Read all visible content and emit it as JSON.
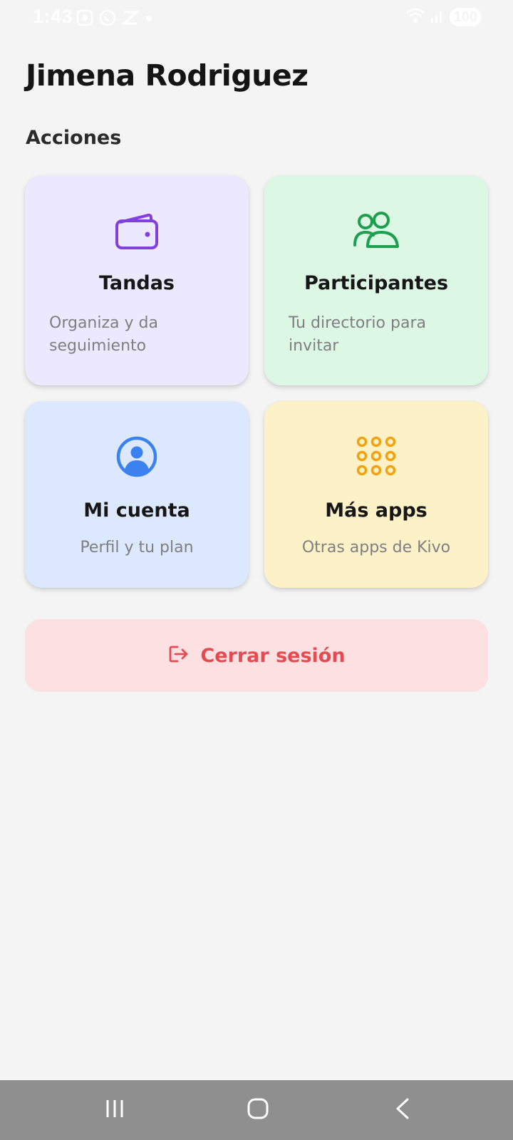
{
  "status_bar": {
    "time": "1:43",
    "battery": "100",
    "left_icons": [
      "screenshot-icon",
      "whatsapp-icon",
      "app-notification-icon",
      "notification-dot-icon"
    ],
    "right_icons": [
      "wifi-icon",
      "signal-icon"
    ]
  },
  "user": {
    "name": "Jimena Rodriguez"
  },
  "section": {
    "title": "Acciones"
  },
  "cards": [
    {
      "title": "Tandas",
      "description": "Organiza y da seguimiento",
      "icon": "wallet-icon",
      "bg": "#ece8fd",
      "icon_color": "#8140db"
    },
    {
      "title": "Participantes",
      "description": "Tu directorio para invitar",
      "icon": "users-icon",
      "bg": "#dcf8e5",
      "icon_color": "#1e9e4e"
    },
    {
      "title": "Mi cuenta",
      "description": "Perfil y tu plan",
      "icon": "user-circle-icon",
      "bg": "#dbe8fd",
      "icon_color": "#3b82f0"
    },
    {
      "title": "Más apps",
      "description": "Otras apps de Kivo",
      "icon": "apps-grid-icon",
      "bg": "#fdf1c7",
      "icon_color": "#f2a20f"
    }
  ],
  "logout": {
    "label": "Cerrar sesión",
    "icon": "logout-icon",
    "bg": "#fde0e2",
    "color": "#e54c52"
  },
  "nav_bar": {
    "buttons": [
      "recent-apps-icon",
      "home-icon",
      "back-icon"
    ]
  }
}
